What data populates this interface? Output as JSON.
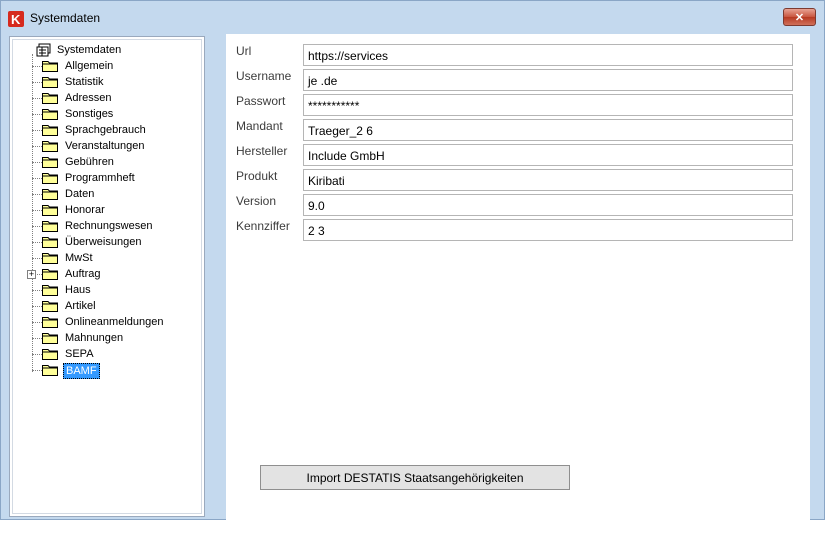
{
  "window": {
    "title": "Systemdaten",
    "logo_text": "K",
    "close_label": "✕"
  },
  "tree": {
    "root_label": "Systemdaten",
    "items": [
      {
        "label": "Allgemein"
      },
      {
        "label": "Statistik"
      },
      {
        "label": "Adressen"
      },
      {
        "label": "Sonstiges"
      },
      {
        "label": "Sprachgebrauch"
      },
      {
        "label": "Veranstaltungen"
      },
      {
        "label": "Gebühren"
      },
      {
        "label": "Programmheft"
      },
      {
        "label": "Daten"
      },
      {
        "label": "Honorar"
      },
      {
        "label": "Rechnungswesen"
      },
      {
        "label": "Überweisungen"
      },
      {
        "label": "MwSt"
      },
      {
        "label": "Auftrag",
        "expander": "+"
      },
      {
        "label": "Haus"
      },
      {
        "label": "Artikel"
      },
      {
        "label": "Onlineanmeldungen"
      },
      {
        "label": "Mahnungen"
      },
      {
        "label": "SEPA"
      },
      {
        "label": "BAMF",
        "selected": true
      }
    ]
  },
  "form": {
    "fields": [
      {
        "label": "Url",
        "value": "https://services"
      },
      {
        "label": "Username",
        "value": "je          .de"
      },
      {
        "label": "Passwort",
        "value": "***********"
      },
      {
        "label": "Mandant",
        "value": "Traeger_2          6"
      },
      {
        "label": "Hersteller",
        "value": "Include GmbH"
      },
      {
        "label": "Produkt",
        "value": "Kiribati"
      },
      {
        "label": "Version",
        "value": "9.0"
      },
      {
        "label": "Kennziffer",
        "value": "2        3"
      }
    ],
    "import_button": "Import DESTATIS Staatsangehörigkeiten"
  },
  "colors": {
    "selection": "#3399ff",
    "frame": "#c4d9ee",
    "close": "#c8553f"
  }
}
